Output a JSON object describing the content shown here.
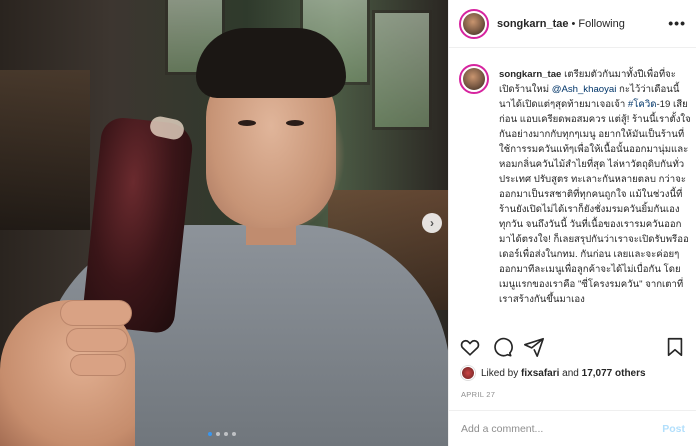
{
  "post": {
    "username": "songkarn_tae",
    "separator": "•",
    "follow_status": "Following",
    "more_label": "•••",
    "caption_prefix": "เตรียมตัวกันมาทั้งปีเพื่อที่จะเปิดร้านใหม่ ",
    "caption_mention": "@Ash_khaoyai",
    "caption_mid": " กะไว้ว่าเดือนนี้นาได้เปิดแต่ๆสุดท้ายมาเจอเจ้า ",
    "caption_hashtag": "#โควิด",
    "caption_body": "-19 เสียก่อน แอบเครียดพอสมควร แต่สู้! ร้านนี้เราตั้งใจกันอย่างมากกับทุกๆเมนู อยากให้มันเป็นร้านที่ใช้การรมควันแท้ๆเพื่อให้เนื้อนั้นออกมานุ่มและหอมกลิ่นควันไม้สำไยที่สุด ไล่หาวัตถุดิบกันทั่วประเทศ ปรับสูตร ทะเลาะกันหลายตลบ กว่าจะออกมาเป็นรสชาติที่ทุกคนถูกใจ แม้ในช่วงนี้ที่ร้านยังเปิดไม่ได้เราก็ยังชั่งมรมควันยิ้มกันเองทุกวัน จนถึงวันนี้ วันที่เนื้อของเรารมควันออกมาได้ตรงใจ! ก็เลยสรุปกันว่าเราจะเปิดรับพรีออเดอร์เพื่อส่งในกทม. กันก่อน เลยและจะค่อยๆออกมาทีละเมนูเพื่อลูกค้าจะได้ไม่เบื่อกัน โดยเมนูแรกของเราคือ \"ซี่โครงรมควัน\" จากเตาที่เราสร้างกันขึ้นมาเอง",
    "liked_by_prefix": "Liked by ",
    "liked_by_user": "fixsafari",
    "liked_by_and": " and ",
    "liked_by_count": "17,077 others",
    "date": "APRIL 27",
    "comment_placeholder": "Add a comment...",
    "post_button": "Post",
    "next_arrow": "›"
  },
  "icons": [
    "heart-icon",
    "comment-icon",
    "share-icon",
    "bookmark-icon",
    "chevron-right-icon"
  ],
  "colors": {
    "link": "#003569",
    "accent": "#3897f0",
    "post_btn": "#b2dffc",
    "muted": "#8e8e8e"
  }
}
